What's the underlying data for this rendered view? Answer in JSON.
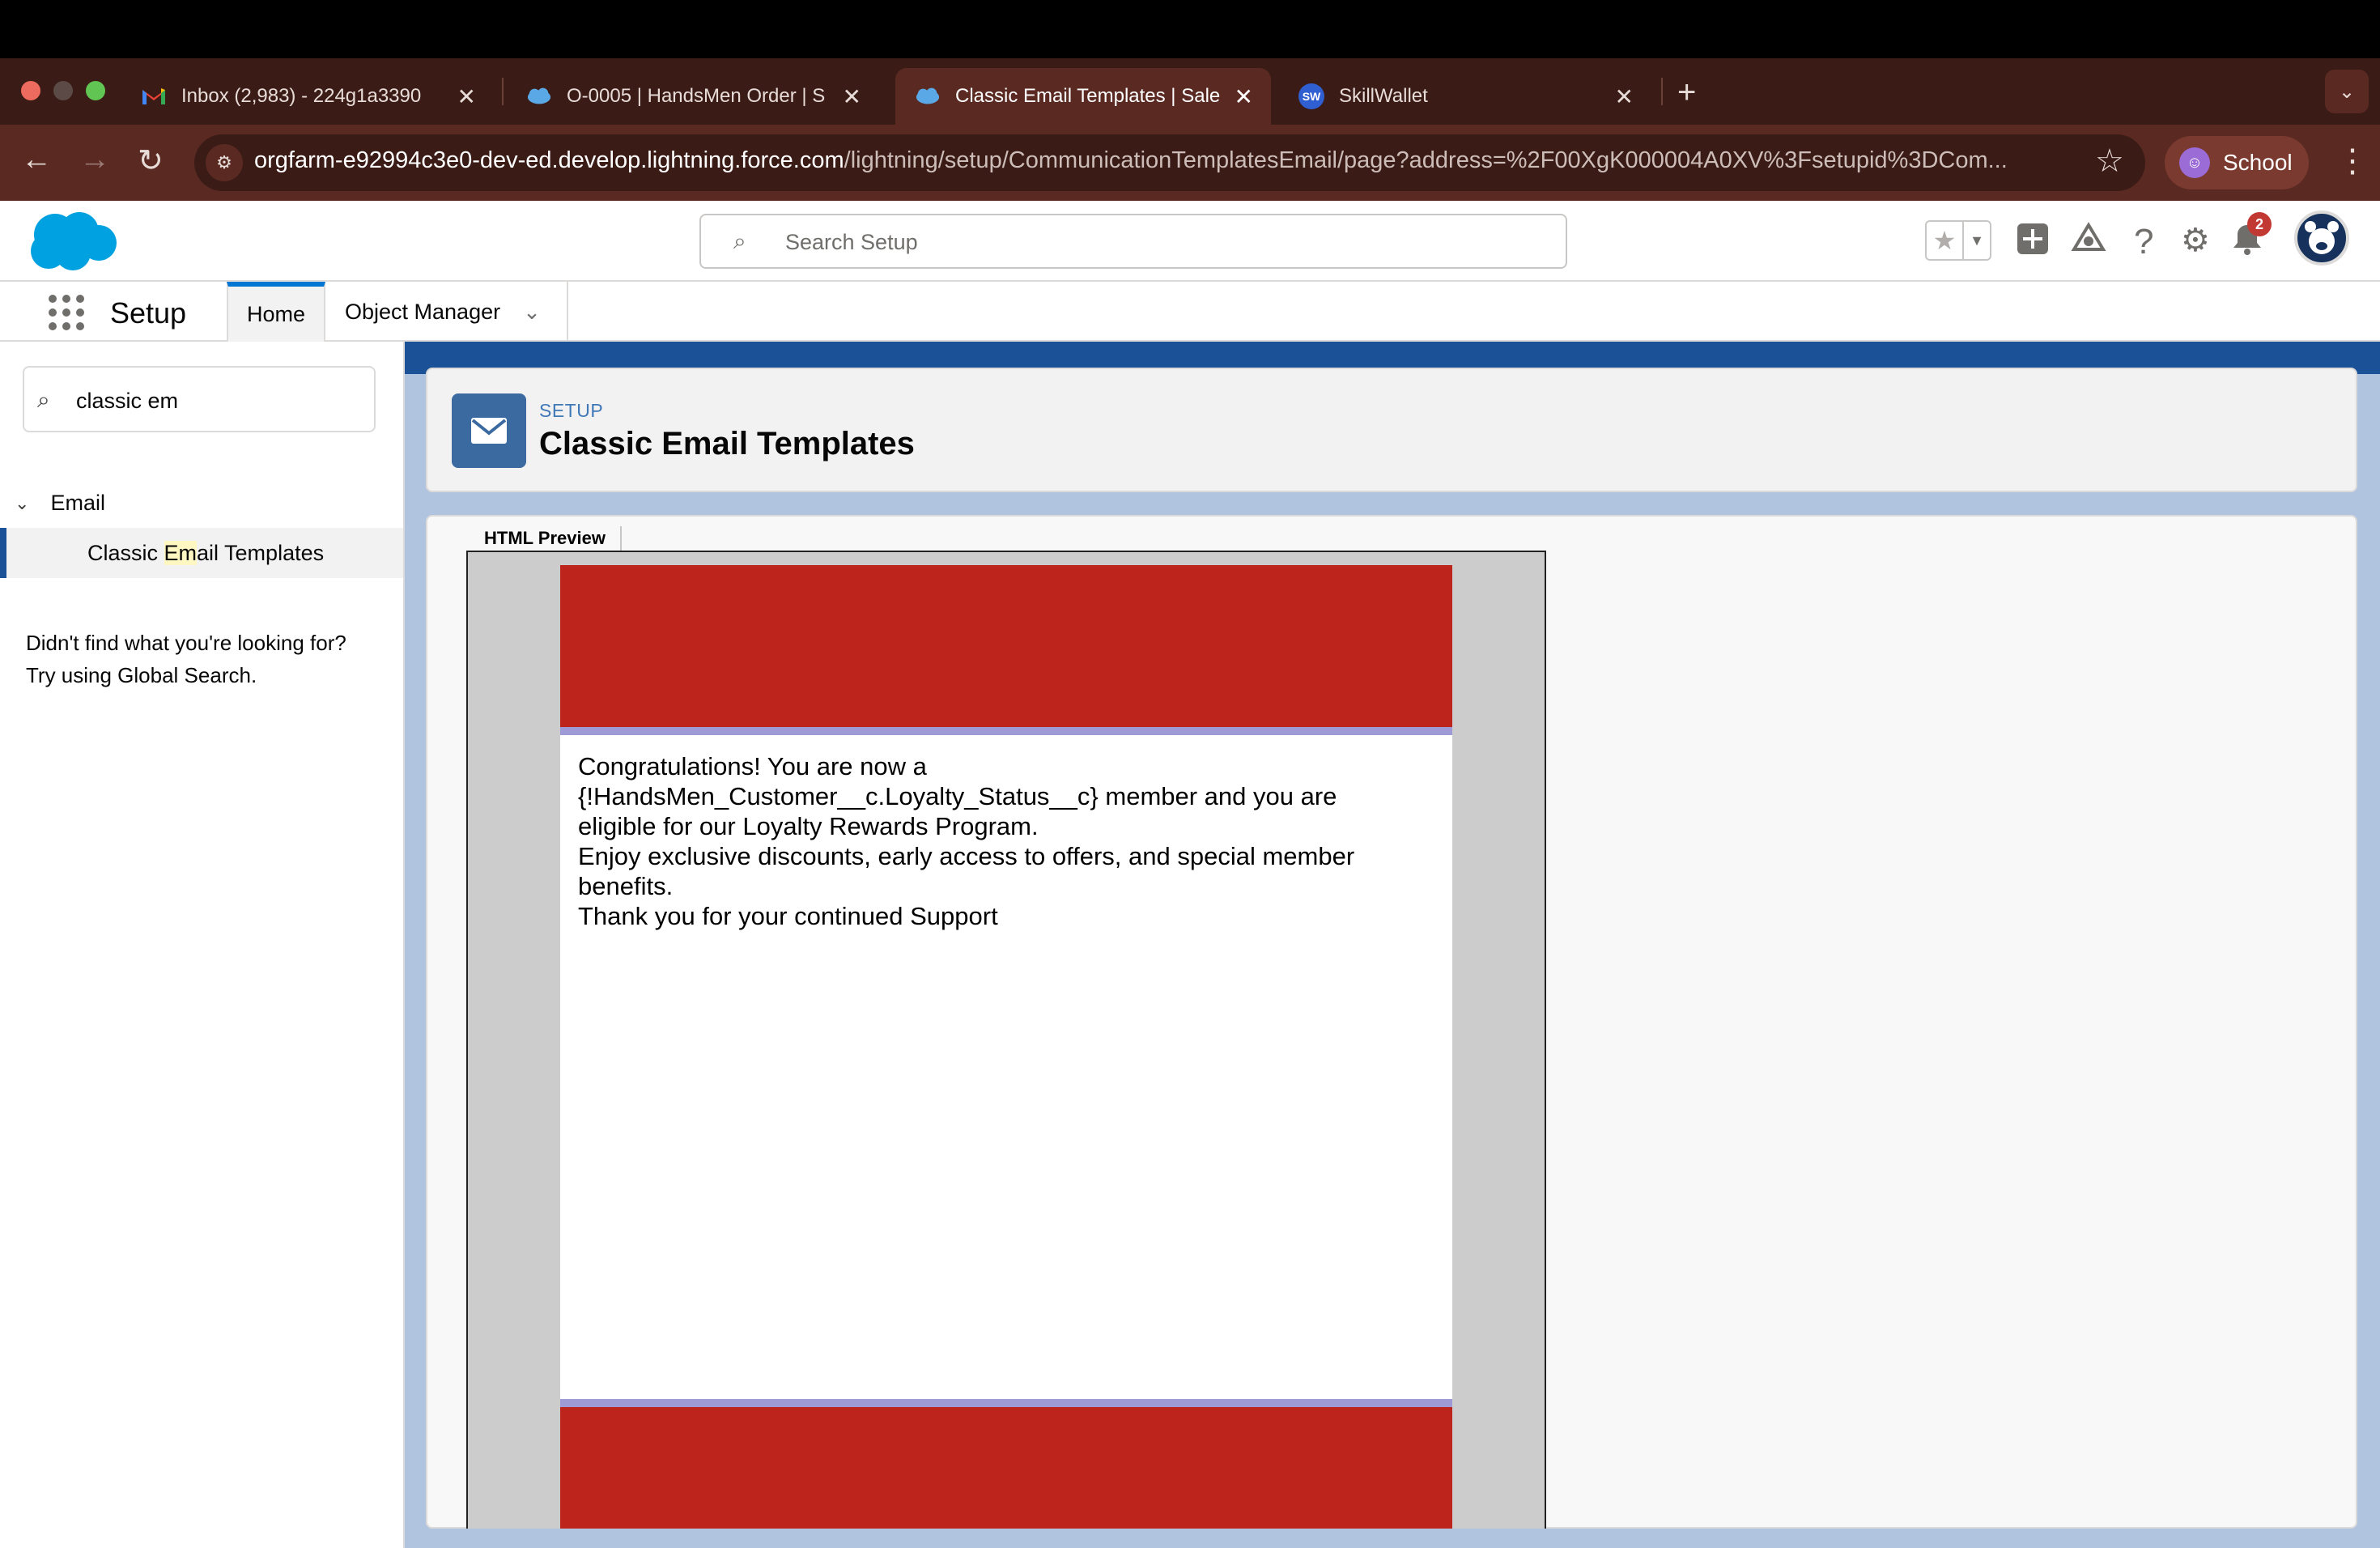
{
  "browser": {
    "tabs": [
      {
        "title": "Inbox (2,983) - 224g1a3390",
        "icon": "gmail-icon"
      },
      {
        "title": "O-0005 | HandsMen Order | S",
        "icon": "salesforce-cloud-icon"
      },
      {
        "title": "Classic Email Templates | Sale",
        "icon": "salesforce-cloud-icon",
        "active": true
      },
      {
        "title": "SkillWallet",
        "icon": "skillwallet-icon",
        "icon_text": "SW"
      }
    ],
    "url_host": "orgfarm-e92994c3e0-dev-ed.develop.lightning.force.com",
    "url_path": "/lightning/setup/CommunicationTemplatesEmail/page?address=%2F00XgK000004A0XV%3Fsetupid%3DCom...",
    "profile_label": "School"
  },
  "header": {
    "search_placeholder": "Search Setup",
    "notification_count": "2"
  },
  "setup_nav": {
    "app_title": "Setup",
    "tabs": [
      {
        "label": "Home"
      },
      {
        "label": "Object Manager"
      }
    ]
  },
  "sidebar": {
    "quick_find_value": "classic em",
    "group_label": "Email",
    "item_prefix": "Classic ",
    "item_highlight": "Em",
    "item_suffix": "ail Templates",
    "help_line1": "Didn't find what you're looking for?",
    "help_line2": "Try using Global Search."
  },
  "page": {
    "kicker": "SETUP",
    "title": "Classic Email Templates",
    "preview_tab_label": "HTML Preview"
  },
  "email": {
    "line1": "Congratulations! You are now a",
    "line2": "{!HandsMen_Customer__c.Loyalty_Status__c} member and you are",
    "line3": "eligible for our Loyalty Rewards Program.",
    "line4": "Enjoy exclusive discounts, early access to offers, and special member",
    "line5": "benefits.",
    "line6": "Thank you for your continued Support"
  },
  "colors": {
    "browser_chrome": "#5a2a22",
    "salesforce_blue": "#0176d3",
    "email_red": "#bc241c",
    "email_rule": "#9d9ad6"
  }
}
